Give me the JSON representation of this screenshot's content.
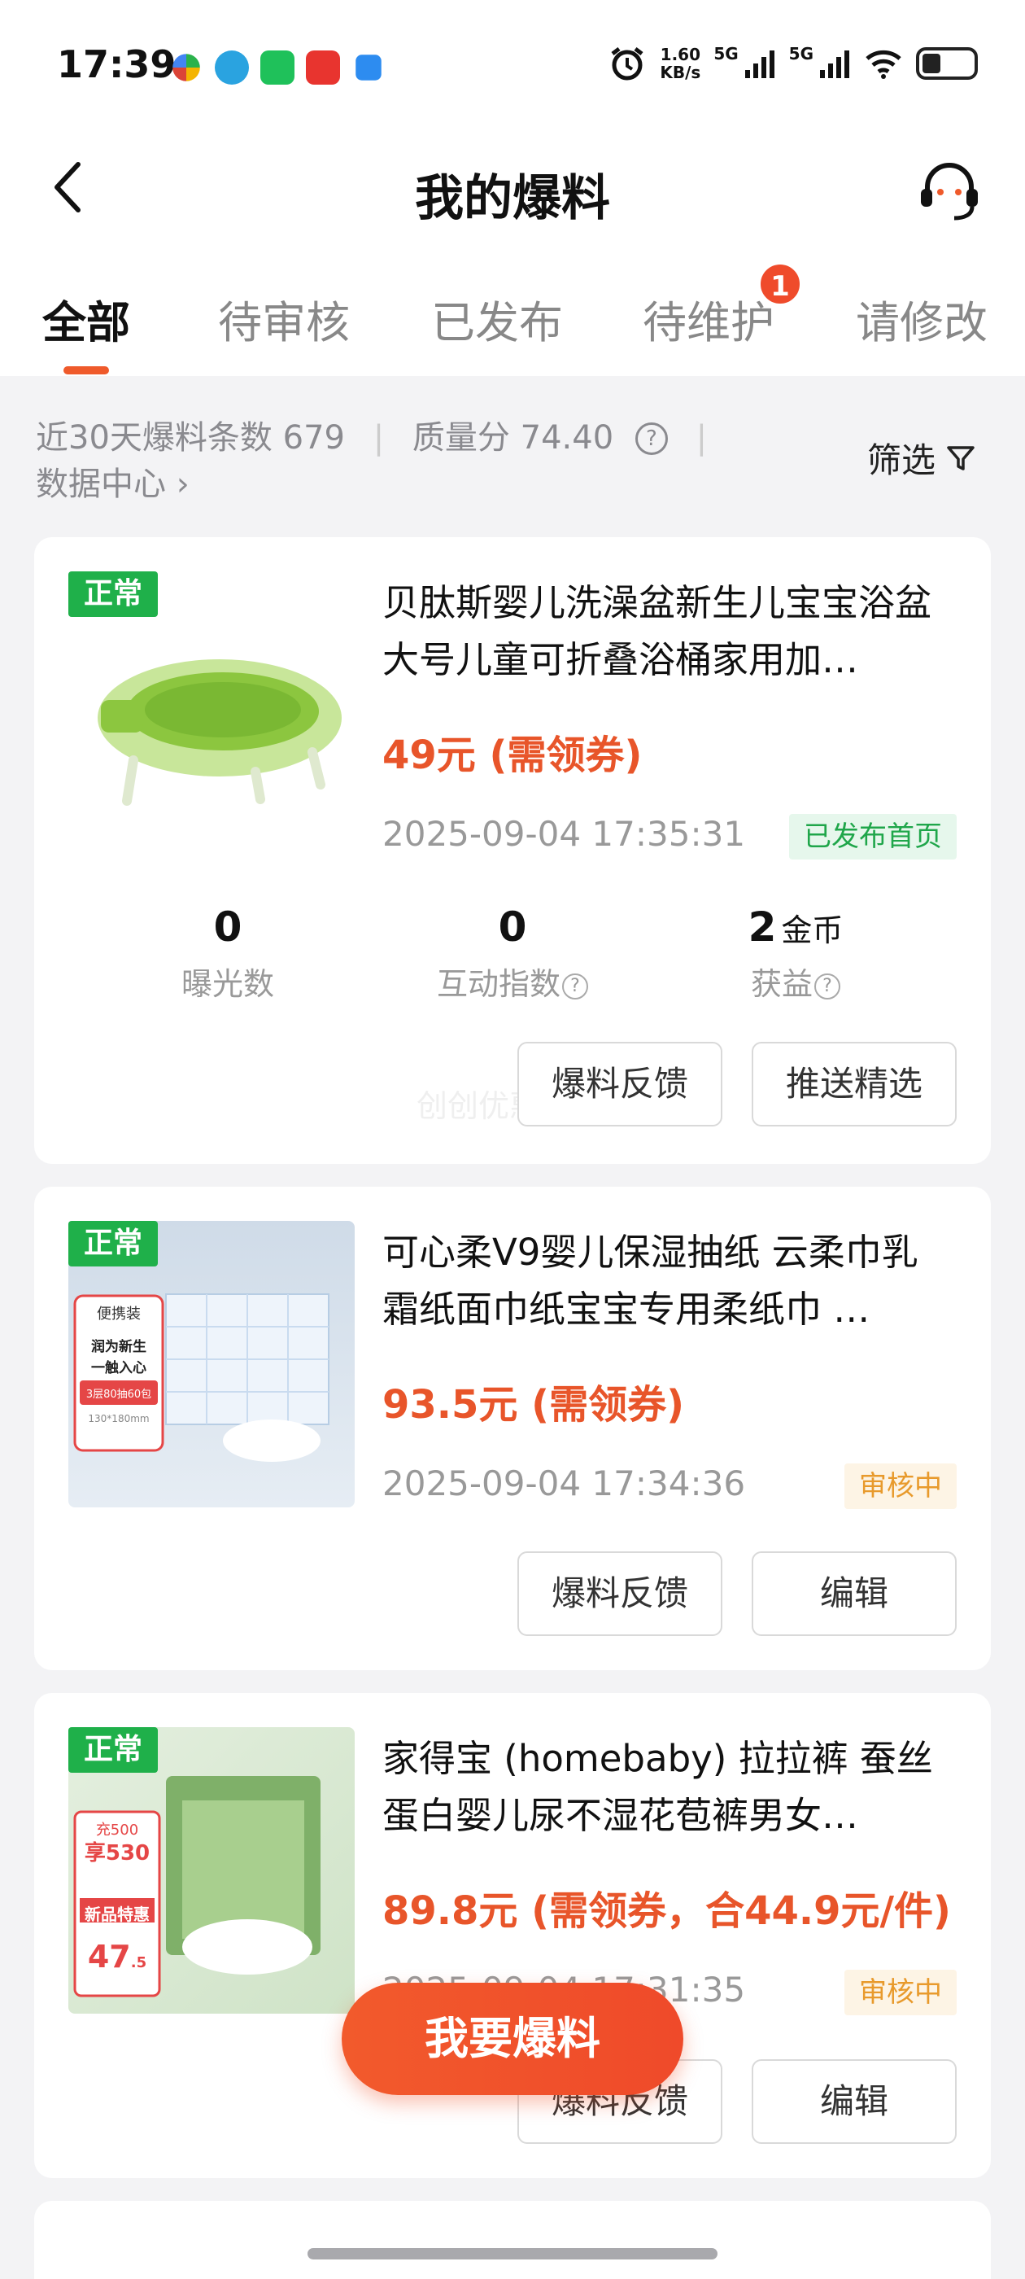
{
  "status_bar": {
    "time": "17:39",
    "net_speed": "1.60",
    "net_speed_unit": "KB/s",
    "signal1": "5G",
    "signal2": "5G"
  },
  "header": {
    "title": "我的爆料"
  },
  "tabs": [
    {
      "label": "全部",
      "active": true
    },
    {
      "label": "待审核"
    },
    {
      "label": "已发布"
    },
    {
      "label": "待维护",
      "badge": "1"
    },
    {
      "label": "请修改"
    }
  ],
  "stats": {
    "count_label": "近30天爆料条数",
    "count_value": "679",
    "quality_label": "质量分",
    "quality_value": "74.40",
    "data_center": "数据中心",
    "filter": "筛选"
  },
  "cards": [
    {
      "tag": "正常",
      "title": "贝肽斯婴儿洗澡盆新生儿宝宝浴盆大号儿童可折叠浴桶家用加…",
      "price": "49元 (需领券)",
      "time": "2025-09-04 17:35:31",
      "status": "已发布首页",
      "metrics": [
        {
          "value": "0",
          "label": "曝光数"
        },
        {
          "value": "0",
          "label": "互动指数"
        },
        {
          "value": "2",
          "unit": "金币",
          "label": "获益"
        }
      ],
      "watermark": "创创优惠",
      "btn1": "爆料反馈",
      "btn2": "推送精选"
    },
    {
      "tag": "正常",
      "title": "可心柔V9婴儿保湿抽纸 云柔巾乳霜纸面巾纸宝宝专用柔纸巾 …",
      "price": "93.5元 (需领券)",
      "time": "2025-09-04 17:34:36",
      "status": "审核中",
      "thumb_text": [
        "便携装",
        "润为新生",
        "一触入心",
        "3层80抽60包",
        "130*180mm"
      ],
      "btn1": "爆料反馈",
      "btn2": "编辑"
    },
    {
      "tag": "正常",
      "title": "家得宝 (homebaby) 拉拉裤 蚕丝蛋白婴儿尿不湿花苞裤男女…",
      "price": "89.8元 (需领券，合44.9元/件)",
      "time": "2025-09-04 17:31:35",
      "status": "审核中",
      "thumb_text": [
        "充500",
        "享530",
        "新品特惠",
        "47",
        ".5"
      ],
      "btn1": "爆料反馈",
      "btn2": "编辑"
    }
  ],
  "fab": "我要爆料",
  "colors": {
    "accent": "#ef5a2b",
    "normal_tag": "#1fb04a",
    "price": "#e8552a"
  }
}
